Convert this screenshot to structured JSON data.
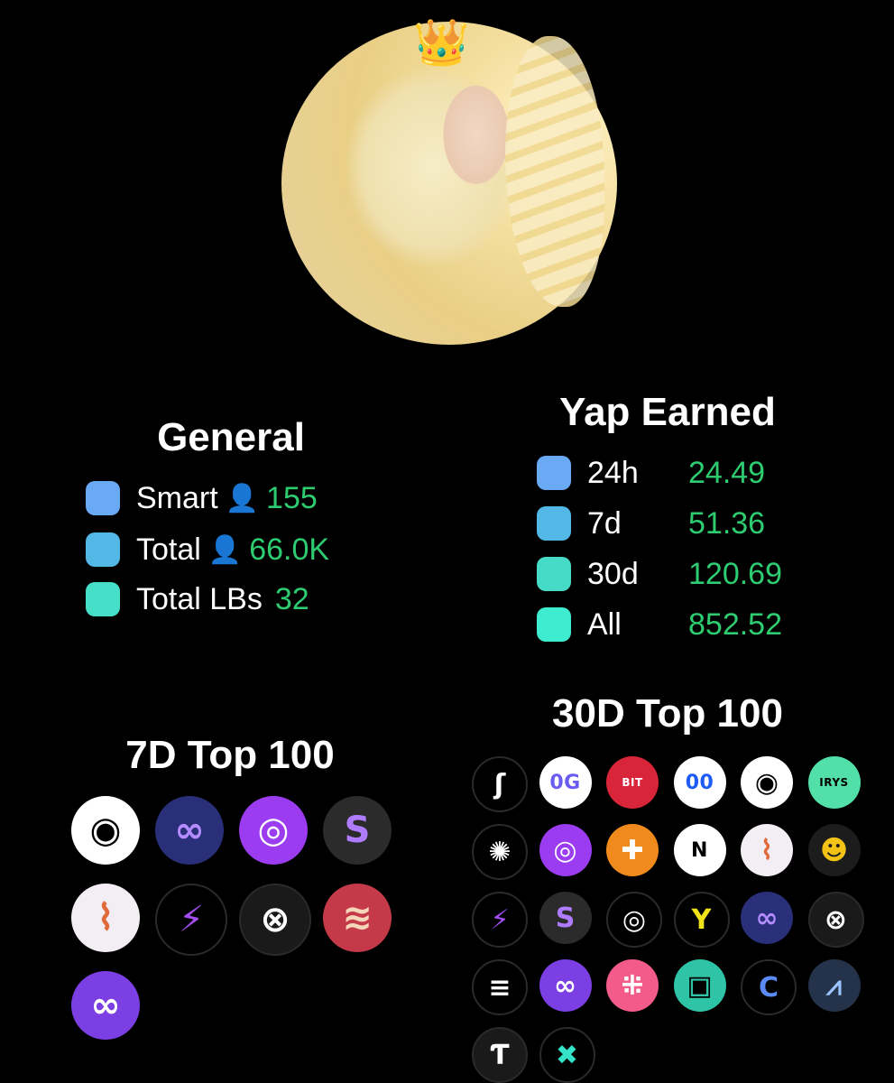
{
  "avatar": {
    "badge": "👑"
  },
  "general": {
    "title": "General",
    "person_icon": "👤",
    "rows": [
      {
        "label": "Smart",
        "value": "155",
        "color": "#6aa9f4",
        "has_icon": true
      },
      {
        "label": "Total",
        "value": "66.0K",
        "color": "#53b8e6",
        "has_icon": true
      },
      {
        "label": "Total LBs",
        "value": "32",
        "color": "#46e0c8",
        "has_icon": false
      }
    ]
  },
  "yap": {
    "title": "Yap Earned",
    "rows": [
      {
        "label": "24h",
        "value": "24.49",
        "color": "#6aa9f4"
      },
      {
        "label": "7d",
        "value": "51.36",
        "color": "#53b8e6"
      },
      {
        "label": "30d",
        "value": "120.69",
        "color": "#46dbc6"
      },
      {
        "label": "All",
        "value": "852.52",
        "color": "#3eedd0"
      }
    ]
  },
  "top7": {
    "title": "7D Top 100",
    "logos": [
      {
        "name": "umbrella-logo",
        "bg": "#ffffff",
        "fg": "#000000",
        "glyph": "◉"
      },
      {
        "name": "infinity-logo",
        "bg": "#2a2f7a",
        "fg": "#b48cff",
        "glyph": "∞"
      },
      {
        "name": "ring-logo",
        "bg": "#9b3cf0",
        "fg": "#ffffff",
        "glyph": "◎"
      },
      {
        "name": "swap-s-logo",
        "bg": "#2b2b2b",
        "fg": "#b07cff",
        "glyph": "S"
      },
      {
        "name": "sneaker-logo",
        "bg": "#f3eef4",
        "fg": "#e06a3a",
        "glyph": "⌇"
      },
      {
        "name": "bolt-logo",
        "bg": "#000000",
        "fg": "#a24df2",
        "glyph": "⚡"
      },
      {
        "name": "x-grid-logo",
        "bg": "#1a1a1a",
        "fg": "#ffffff",
        "glyph": "⊗"
      },
      {
        "name": "wave-logo",
        "bg": "#c43a48",
        "fg": "#f5d6b8",
        "glyph": "≋"
      },
      {
        "name": "polygon-logo",
        "bg": "#7b3fe4",
        "fg": "#ffffff",
        "glyph": "∞"
      }
    ]
  },
  "top30": {
    "title": "30D Top 100",
    "logos": [
      {
        "name": "flame-logo",
        "bg": "#000000",
        "fg": "#ffffff",
        "glyph": "ʃ",
        "label": ""
      },
      {
        "name": "og-logo",
        "bg": "#ffffff",
        "fg": "#6a5cf0",
        "glyph": "",
        "label": "0G"
      },
      {
        "name": "bit-logo",
        "bg": "#d9253a",
        "fg": "#ffffff",
        "glyph": "",
        "label": "BIT"
      },
      {
        "name": "robot-logo",
        "bg": "#ffffff",
        "fg": "#1f5cf5",
        "glyph": "",
        "label": "00"
      },
      {
        "name": "umbrella-logo",
        "bg": "#ffffff",
        "fg": "#000000",
        "glyph": "◉",
        "label": ""
      },
      {
        "name": "irys-logo",
        "bg": "#52e0a8",
        "fg": "#000000",
        "glyph": "",
        "label": "IRYS"
      },
      {
        "name": "burst-logo",
        "bg": "#000000",
        "fg": "#ffffff",
        "glyph": "✺",
        "label": ""
      },
      {
        "name": "ring-logo",
        "bg": "#9b3cf0",
        "fg": "#ffffff",
        "glyph": "◎",
        "label": ""
      },
      {
        "name": "plus-logo",
        "bg": "#f08a1c",
        "fg": "#ffffff",
        "glyph": "✚",
        "label": ""
      },
      {
        "name": "near-logo",
        "bg": "#ffffff",
        "fg": "#000000",
        "glyph": "",
        "label": "N"
      },
      {
        "name": "sneaker-logo",
        "bg": "#f3eef4",
        "fg": "#e06a3a",
        "glyph": "⌇",
        "label": ""
      },
      {
        "name": "bee-logo",
        "bg": "#1c1c1c",
        "fg": "#f2c316",
        "glyph": "☻",
        "label": ""
      },
      {
        "name": "bolt-logo",
        "bg": "#000000",
        "fg": "#a24df2",
        "glyph": "⚡",
        "label": ""
      },
      {
        "name": "swap-s-logo",
        "bg": "#2b2b2b",
        "fg": "#b07cff",
        "glyph": "S",
        "label": ""
      },
      {
        "name": "target-logo",
        "bg": "#000000",
        "fg": "#ffffff",
        "glyph": "◎",
        "label": ""
      },
      {
        "name": "y-logo",
        "bg": "#000000",
        "fg": "#f2e318",
        "glyph": "Y",
        "label": ""
      },
      {
        "name": "infinity-logo",
        "bg": "#2a2f7a",
        "fg": "#b48cff",
        "glyph": "∞",
        "label": ""
      },
      {
        "name": "x-grid-logo",
        "bg": "#1a1a1a",
        "fg": "#ffffff",
        "glyph": "⊗",
        "label": ""
      },
      {
        "name": "stripes-logo",
        "bg": "#000000",
        "fg": "#ffffff",
        "glyph": "≡",
        "label": ""
      },
      {
        "name": "polygon-logo",
        "bg": "#7b3fe4",
        "fg": "#ffffff",
        "glyph": "∞",
        "label": ""
      },
      {
        "name": "dots-logo",
        "bg": "#f25b8a",
        "fg": "#ffffff",
        "glyph": "⁜",
        "label": ""
      },
      {
        "name": "block-logo",
        "bg": "#2fc4a6",
        "fg": "#000000",
        "glyph": "▣",
        "label": ""
      },
      {
        "name": "c-arc-logo",
        "bg": "#000000",
        "fg": "#5b8af5",
        "glyph": "C",
        "label": ""
      },
      {
        "name": "arbitrum-logo",
        "bg": "#24324a",
        "fg": "#9ac4ff",
        "glyph": "⩘",
        "label": ""
      },
      {
        "name": "f-logo",
        "bg": "#1a1a1a",
        "fg": "#ffffff",
        "glyph": "Ƭ",
        "label": ""
      },
      {
        "name": "x-cross-logo",
        "bg": "#000000",
        "fg": "#34e3c8",
        "glyph": "✖",
        "label": ""
      }
    ]
  }
}
